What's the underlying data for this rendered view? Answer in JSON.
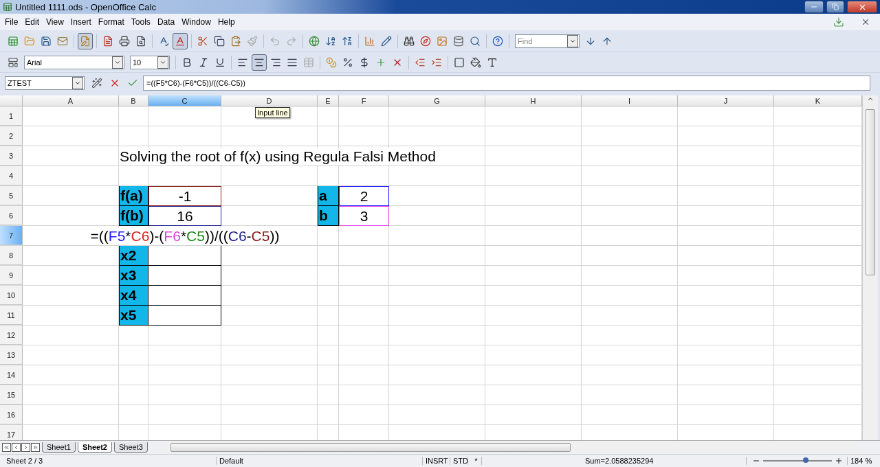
{
  "window": {
    "title": "Untitled 1111.ods - OpenOffice Calc"
  },
  "menu": [
    "File",
    "Edit",
    "View",
    "Insert",
    "Format",
    "Tools",
    "Data",
    "Window",
    "Help"
  ],
  "standard_toolbar": {
    "edit_mode": true,
    "autospellcheck": true,
    "find": {
      "placeholder": "Find"
    }
  },
  "formatting_toolbar": {
    "font": "Arial",
    "size": "10",
    "alignment": [
      {
        "selected": false
      },
      {
        "selected": true
      },
      {
        "selected": false
      },
      {
        "selected": false
      }
    ]
  },
  "formula_bar": {
    "name_box": "ZTEST",
    "formula": "=((F5*C6)-(F6*C5))/((C6-C5))"
  },
  "tooltip": "Input line",
  "columns": [
    {
      "label": "A",
      "selected": false
    },
    {
      "label": "B",
      "selected": false
    },
    {
      "label": "C",
      "selected": true
    },
    {
      "label": "D",
      "selected": false
    },
    {
      "label": "E",
      "selected": false
    },
    {
      "label": "F",
      "selected": false
    },
    {
      "label": "G",
      "selected": false
    },
    {
      "label": "H",
      "selected": false
    },
    {
      "label": "I",
      "selected": false
    },
    {
      "label": "J",
      "selected": false
    },
    {
      "label": "K",
      "selected": false
    }
  ],
  "rows": [
    {
      "number": "1",
      "selected": false
    },
    {
      "number": "2",
      "selected": false
    },
    {
      "number": "3",
      "selected": false,
      "cells": [
        null,
        {
          "kind": "title",
          "text": "Solving the root of f(x) using Regula Falsi Method"
        }
      ]
    },
    {
      "number": "4",
      "selected": false
    },
    {
      "number": "5",
      "selected": false,
      "cells": [
        null,
        {
          "kind": "label",
          "text": "f(a)"
        },
        {
          "kind": "value",
          "text": "-1",
          "color": "#8a1a1a"
        },
        null,
        {
          "kind": "label",
          "text": "a"
        },
        {
          "kind": "value",
          "text": "2",
          "color": "#1a1aff"
        }
      ]
    },
    {
      "number": "6",
      "selected": false,
      "cells": [
        null,
        {
          "kind": "label",
          "text": "f(b)"
        },
        {
          "kind": "value",
          "text": "16",
          "color": "#1a1a8a"
        },
        null,
        {
          "kind": "label",
          "text": "b"
        },
        {
          "kind": "value",
          "text": "3",
          "color": "#e040e0"
        }
      ]
    },
    {
      "number": "7",
      "selected": true,
      "cells": [
        null,
        null,
        {
          "kind": "formula",
          "segments": [
            {
              "text": "=(("
            },
            {
              "text": "F5",
              "color": "#1a1aff"
            },
            {
              "text": "*"
            },
            {
              "text": "C6",
              "color": "#e0201a"
            },
            {
              "text": ")-("
            },
            {
              "text": "F6",
              "color": "#e040e0"
            },
            {
              "text": "*"
            },
            {
              "text": "C5",
              "color": "#1a8a1a"
            },
            {
              "text": "))/(("
            },
            {
              "text": "C6",
              "color": "#1a1a8a"
            },
            {
              "text": "-"
            },
            {
              "text": "C5",
              "color": "#8a1a1a"
            },
            {
              "text": "))"
            }
          ]
        }
      ]
    },
    {
      "number": "8",
      "selected": false,
      "cells": [
        null,
        {
          "kind": "label",
          "text": "x2"
        },
        {
          "kind": "input"
        }
      ]
    },
    {
      "number": "9",
      "selected": false,
      "cells": [
        null,
        {
          "kind": "label",
          "text": "x3"
        },
        {
          "kind": "input"
        }
      ]
    },
    {
      "number": "10",
      "selected": false,
      "cells": [
        null,
        {
          "kind": "label",
          "text": "x4"
        },
        {
          "kind": "input"
        }
      ]
    },
    {
      "number": "11",
      "selected": false,
      "cells": [
        null,
        {
          "kind": "label",
          "text": "x5"
        },
        {
          "kind": "input"
        }
      ]
    },
    {
      "number": "12",
      "selected": false
    },
    {
      "number": "13",
      "selected": false
    },
    {
      "number": "14",
      "selected": false
    },
    {
      "number": "15",
      "selected": false
    },
    {
      "number": "16",
      "selected": false
    },
    {
      "number": "17",
      "selected": false
    }
  ],
  "sheet_tabs": [
    {
      "label": "Sheet1",
      "selected": false
    },
    {
      "label": "Sheet2",
      "selected": true
    },
    {
      "label": "Sheet3",
      "selected": false
    }
  ],
  "status_bar": {
    "sheet": "Sheet 2 / 3",
    "style": "Default",
    "mode": "INSRT",
    "selection": "STD",
    "modified": "*",
    "sum": "Sum=2.0588235294",
    "zoom": {
      "level": 0.62,
      "reading": "184 %"
    }
  }
}
